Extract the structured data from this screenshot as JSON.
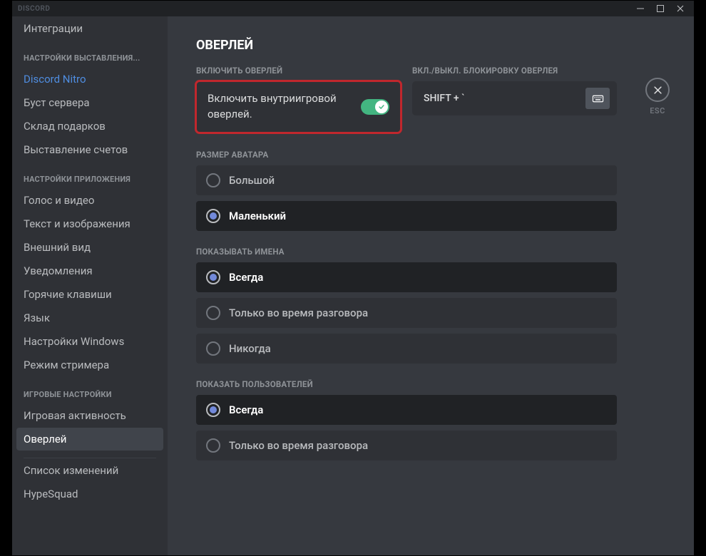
{
  "titlebar": {
    "brand": "DISCORD"
  },
  "esc": {
    "label": "ESC"
  },
  "sidebar": {
    "groups": [
      {
        "items": [
          {
            "label": "Интеграции"
          }
        ]
      },
      {
        "heading": "НАСТРОЙКИ ВЫСТАВЛЕНИЯ...",
        "items": [
          {
            "label": "Discord Nitro",
            "nitro": true
          },
          {
            "label": "Буст сервера"
          },
          {
            "label": "Склад подарков"
          },
          {
            "label": "Выставление счетов"
          }
        ]
      },
      {
        "heading": "НАСТРОЙКИ ПРИЛОЖЕНИЯ",
        "items": [
          {
            "label": "Голос и видео"
          },
          {
            "label": "Текст и изображения"
          },
          {
            "label": "Внешний вид"
          },
          {
            "label": "Уведомления"
          },
          {
            "label": "Горячие клавиши"
          },
          {
            "label": "Язык"
          },
          {
            "label": "Настройки Windows"
          },
          {
            "label": "Режим стримера"
          }
        ]
      },
      {
        "heading": "ИГРОВЫЕ НАСТРОЙКИ",
        "items": [
          {
            "label": "Игровая активность"
          },
          {
            "label": "Оверлей",
            "selected": true
          }
        ]
      },
      {
        "sep": true,
        "items": [
          {
            "label": "Список изменений"
          },
          {
            "label": "HypeSquad"
          }
        ]
      }
    ]
  },
  "page": {
    "title": "ОВЕРЛЕЙ",
    "enable": {
      "heading": "ВКЛЮЧИТЬ ОВЕРЛЕЙ",
      "text": "Включить внутриигровой оверлей.",
      "on": true
    },
    "lock": {
      "heading": "ВКЛ./ВЫКЛ. БЛОКИРОВКУ ОВЕРЛЕЯ",
      "value": "SHIFT + `"
    },
    "avatar": {
      "heading": "РАЗМЕР АВАТАРА",
      "options": [
        {
          "label": "Большой"
        },
        {
          "label": "Маленький",
          "sel": true
        }
      ]
    },
    "names": {
      "heading": "ПОКАЗЫВАТЬ ИМЕНА",
      "options": [
        {
          "label": "Всегда",
          "sel": true
        },
        {
          "label": "Только во время разговора"
        },
        {
          "label": "Никогда"
        }
      ]
    },
    "users": {
      "heading": "ПОКАЗАТЬ ПОЛЬЗОВАТЕЛЕЙ",
      "options": [
        {
          "label": "Всегда",
          "sel": true
        },
        {
          "label": "Только во время разговора"
        }
      ]
    }
  }
}
